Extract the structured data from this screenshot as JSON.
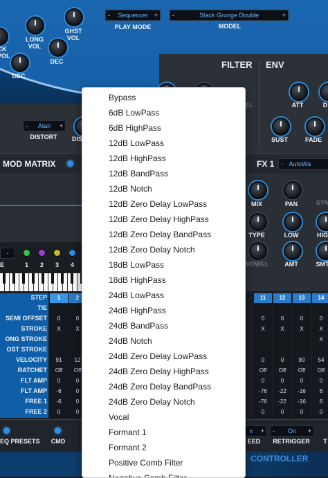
{
  "top": {
    "knob_labels": {
      "ck_vol": "CK\nVOL",
      "long_vol": "LONG\nVOL",
      "ghst_vol": "GHST\nVOL",
      "dec_left": "DEC",
      "dec_mid": "DEC"
    },
    "play_mode": {
      "value": "Sequencer",
      "label": "PLAY MODE",
      "minus": "-",
      "plus": "+"
    },
    "model": {
      "value": "Stack Grunge Double",
      "label": "MODEL",
      "minus": "-",
      "plus": "+"
    },
    "filter_title": "FILTER",
    "env_title": "ENV",
    "env_knobs": {
      "att": "ATT",
      "d": "D",
      "sust": "SUST",
      "fade": "FADE"
    },
    "distort": {
      "value": "Atan",
      "label": "DISTORT",
      "minus": "-",
      "plus": "+",
      "partial_label": "DIS"
    },
    "filter_partial_label": "EL"
  },
  "band": {
    "mod_matrix": "MOD MATRIX",
    "fx1": "FX 1",
    "fx_preset": "AutoWa",
    "fx_minus": "-"
  },
  "fx_knobs": {
    "mix": "MIX",
    "pan": "PAN",
    "syn": "SYN",
    "type": "TYPE",
    "low": "LOW",
    "hig": "HIG",
    "vowel": "VOWEL",
    "amt": "AMT",
    "smt": "SMT"
  },
  "lfo": {
    "mode_minus": "-",
    "mode_label": "E",
    "numbers": [
      "1",
      "2",
      "3",
      "4"
    ],
    "colors": [
      "#33c24a",
      "#9b3fd6",
      "#c7b82a",
      "#2a8fe6"
    ]
  },
  "steps": {
    "header_label": "STEP",
    "row_labels": [
      "TIE",
      "SEMI OFFSET",
      "STROKE",
      "ONG STROKE",
      "OST STROKE",
      "VELOCITY",
      "RATCHET",
      "FLT AMP",
      "FLT AMP",
      "FREE 1",
      "FREE 2"
    ],
    "left_columns": [
      {
        "step": "1",
        "cells": [
          "",
          "0",
          "X",
          "",
          "",
          "91",
          "Off",
          "0",
          "-6",
          "-6",
          "0"
        ]
      },
      {
        "step": "2",
        "cells": [
          "",
          "0",
          "X",
          "",
          "",
          "12",
          "Off",
          "0",
          "0",
          "0",
          "0"
        ]
      }
    ],
    "right_columns": [
      {
        "step": "11",
        "cells": [
          "",
          "0",
          "X",
          "",
          "",
          "0",
          "Off",
          "0",
          "-76",
          "-76",
          "0"
        ]
      },
      {
        "step": "12",
        "cells": [
          "",
          "0",
          "X",
          "",
          "",
          "0",
          "Off",
          "0",
          "-22",
          "-22",
          "0"
        ]
      },
      {
        "step": "13",
        "cells": [
          "",
          "0",
          "X",
          "",
          "",
          "90",
          "Off",
          "0",
          "-16",
          "-16",
          "0"
        ]
      },
      {
        "step": "14",
        "cells": [
          "",
          "0",
          "X",
          "X",
          "",
          "54",
          "Off",
          "0",
          "6",
          "6",
          "0"
        ]
      }
    ]
  },
  "bottom": {
    "eq_presets": "EQ PRESETS",
    "cmd": "CMD",
    "speed": "EED",
    "retrigger": {
      "value": "On",
      "label": "RETRIGGER",
      "minus": "-",
      "plus": "+"
    },
    "speed_selector": {
      "value": "x",
      "minus": "-",
      "plus": "+"
    },
    "controller": "CONTROLLER",
    "partial_t": "T"
  },
  "filter_menu": {
    "items": [
      "Bypass",
      "6dB LowPass",
      "6dB HighPass",
      "12dB LowPass",
      "12dB HighPass",
      "12dB BandPass",
      "12dB Notch",
      "12dB Zero Delay LowPass",
      "12dB Zero Delay HighPass",
      "12dB Zero Delay BandPass",
      "12dB Zero Delay Notch",
      "18dB LowPass",
      "18dB HighPass",
      "24dB LowPass",
      "24dB HighPass",
      "24dB BandPass",
      "24dB Notch",
      "24dB Zero Delay LowPass",
      "24dB Zero Delay HighPass",
      "24dB Zero Delay BandPass",
      "24dB Zero Delay Notch",
      "Vocal",
      "Formant 1",
      "Formant 2",
      "Positive Comb Filter",
      "Negative Comb Filter"
    ]
  }
}
